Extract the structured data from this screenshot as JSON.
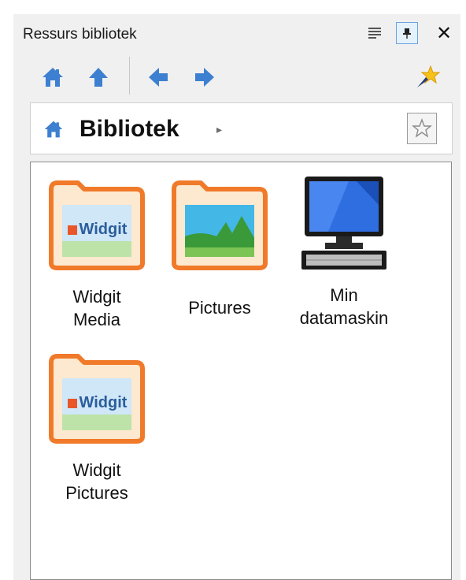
{
  "panel": {
    "title": "Ressurs bibliotek",
    "buttons": [
      "list-view-icon",
      "pin-icon",
      "close-icon"
    ],
    "close_glyph": "✕"
  },
  "toolbar": {
    "icons": [
      "home-icon",
      "up-arrow-icon",
      "back-arrow-icon",
      "forward-arrow-icon",
      "favorites-star-icon"
    ]
  },
  "address": {
    "label": "Bibliotek",
    "chevron": "▸"
  },
  "items": [
    {
      "label_line1": "Widgit",
      "label_line2": "Media",
      "type": "folder-widgit",
      "badge": "Widgit"
    },
    {
      "label_line1": "Pictures",
      "label_line2": "",
      "type": "folder-pictures"
    },
    {
      "label_line1": "Min",
      "label_line2": "datamaskin",
      "type": "computer"
    },
    {
      "label_line1": "Widgit",
      "label_line2": "Pictures",
      "type": "folder-widgit",
      "badge": "Widgit"
    }
  ],
  "colors": {
    "accent_blue": "#3d7fd0",
    "folder_orange": "#f07a2a",
    "folder_fill": "#fde9cf"
  }
}
